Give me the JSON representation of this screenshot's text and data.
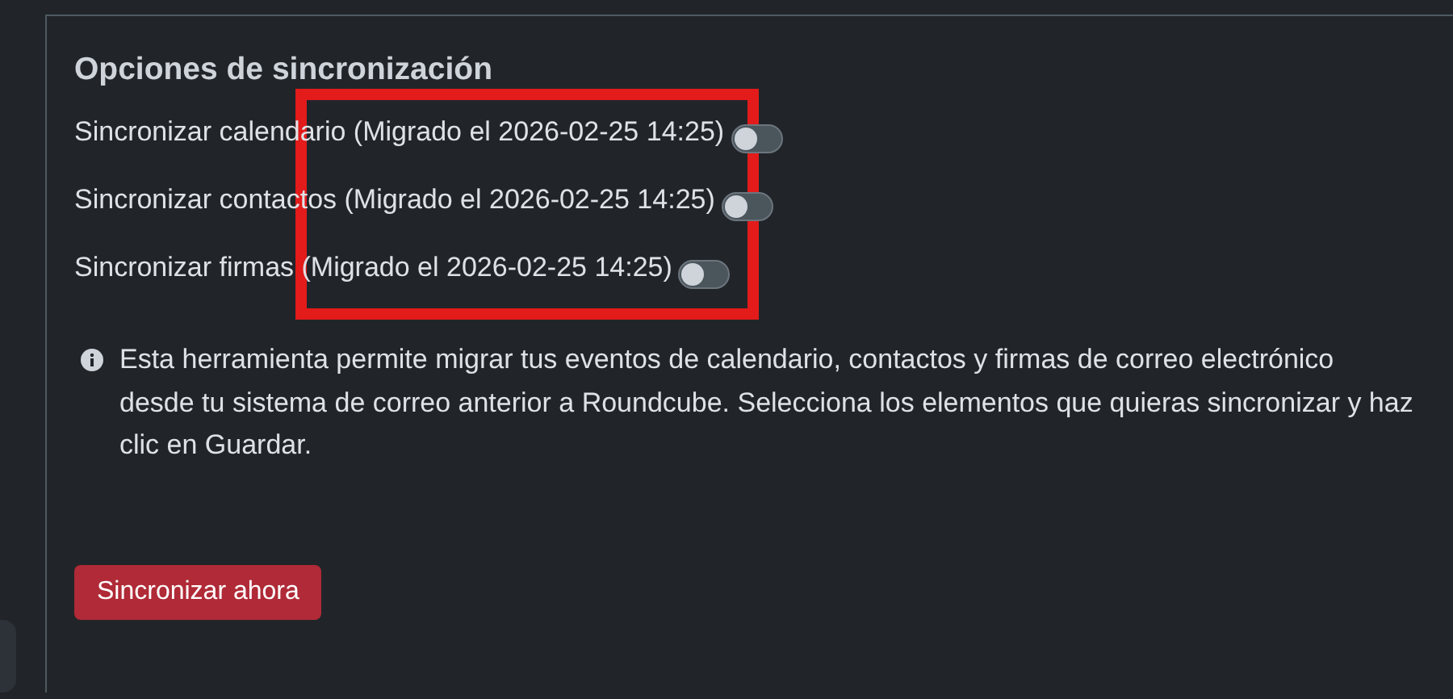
{
  "section": {
    "title": "Opciones de sincronización",
    "options": [
      {
        "label": "Sincronizar calendario (Migrado el 2026-02-25 14:25)",
        "on": false
      },
      {
        "label": "Sincronizar contactos (Migrado el 2026-02-25 14:25)",
        "on": false
      },
      {
        "label": "Sincronizar firmas (Migrado el 2026-02-25 14:25)",
        "on": false
      }
    ],
    "info": "Esta herramienta permite migrar tus eventos de calendario, contactos y firmas de correo electrónico desde tu sistema de correo anterior a Roundcube. Selecciona los elementos que quieras sincronizar y haz clic en Guardar.",
    "button": "Sincronizar ahora"
  }
}
